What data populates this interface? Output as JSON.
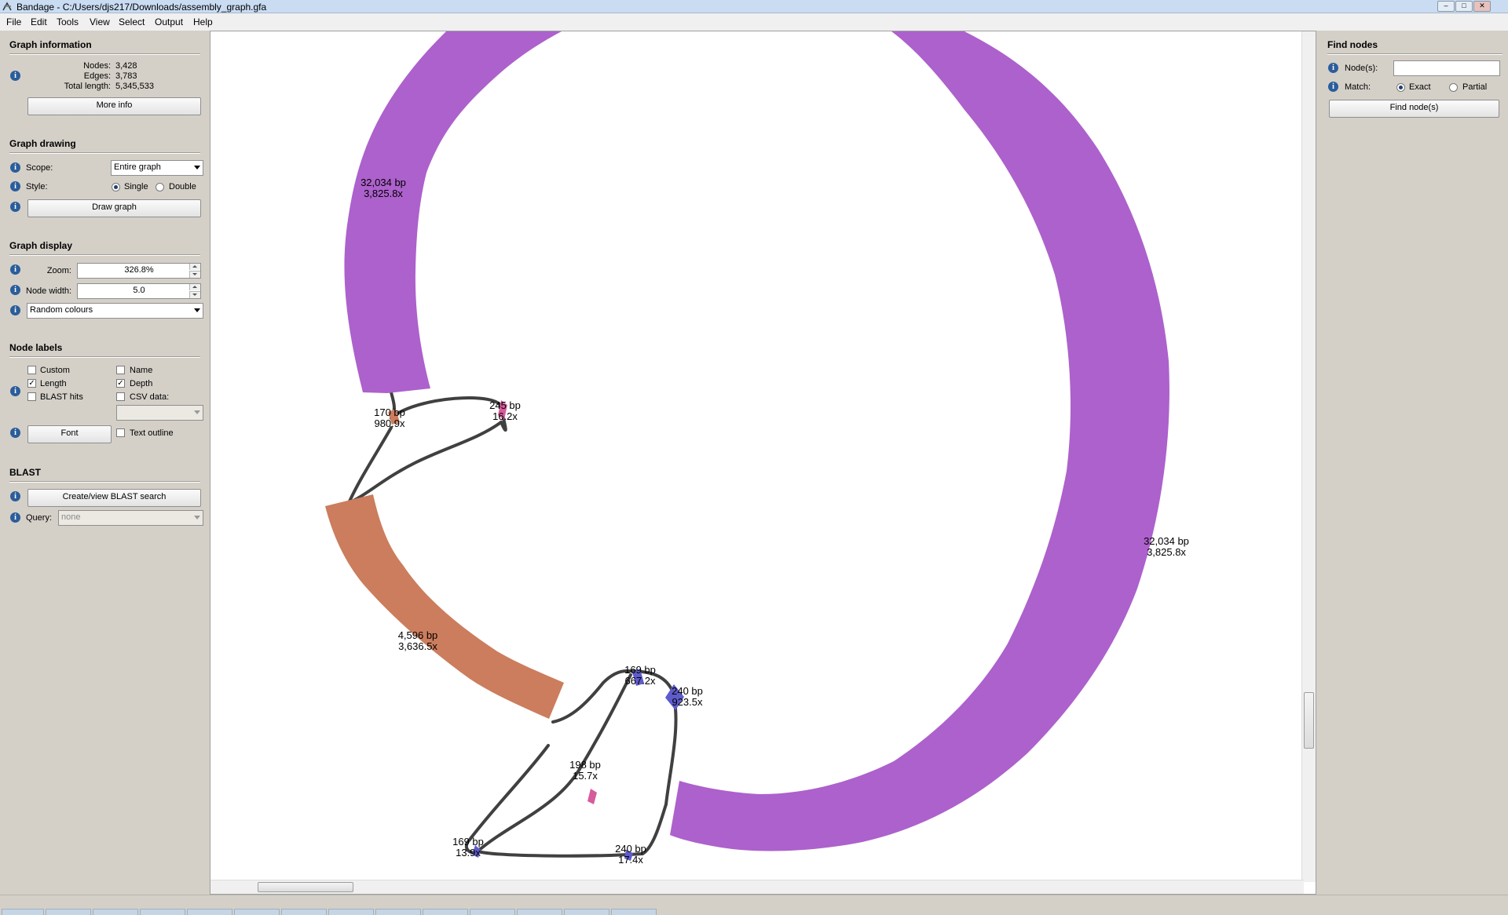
{
  "window": {
    "title": "Bandage - C:/Users/djs217/Downloads/assembly_graph.gfa"
  },
  "menu": [
    "File",
    "Edit",
    "Tools",
    "View",
    "Select",
    "Output",
    "Help"
  ],
  "graph_information": {
    "title": "Graph information",
    "nodes_label": "Nodes:",
    "nodes": "3,428",
    "edges_label": "Edges:",
    "edges": "3,783",
    "total_length_label": "Total length:",
    "total_length": "5,345,533",
    "more_info": "More info"
  },
  "graph_drawing": {
    "title": "Graph drawing",
    "scope_label": "Scope:",
    "scope_value": "Entire graph",
    "style_label": "Style:",
    "style_single": "Single",
    "style_double": "Double",
    "style_selected": "Single",
    "draw_graph": "Draw graph"
  },
  "graph_display": {
    "title": "Graph display",
    "zoom_label": "Zoom:",
    "zoom_value": "326.8%",
    "node_width_label": "Node width:",
    "node_width_value": "5.0",
    "colour_scheme": "Random colours"
  },
  "node_labels": {
    "title": "Node labels",
    "custom": "Custom",
    "custom_checked": false,
    "name": "Name",
    "name_checked": false,
    "length": "Length",
    "length_checked": true,
    "depth": "Depth",
    "depth_checked": true,
    "blast_hits": "BLAST hits",
    "blast_hits_checked": false,
    "csv_data": "CSV data:",
    "csv_data_checked": false,
    "font": "Font",
    "text_outline": "Text outline",
    "text_outline_checked": false
  },
  "blast": {
    "title": "BLAST",
    "create_view": "Create/view BLAST search",
    "query_label": "Query:",
    "query_value": "none"
  },
  "find_nodes": {
    "title": "Find nodes",
    "nodes_label": "Node(s):",
    "nodes_value": "",
    "match_label": "Match:",
    "match_exact": "Exact",
    "match_partial": "Partial",
    "match_selected": "Exact",
    "find_button": "Find node(s)"
  },
  "graph": {
    "colors": {
      "purple": "#ad61cc",
      "orange": "#cc7d5d",
      "pink": "#d65c9c",
      "blue": "#5e5ccc",
      "edge": "#404040"
    },
    "labels": [
      {
        "bp": "32,034 bp",
        "depth": "3,825.8x"
      },
      {
        "bp": "32,034 bp",
        "depth": "3,825.8x"
      },
      {
        "bp": "170 bp",
        "depth": "980.9x"
      },
      {
        "bp": "245 bp",
        "depth": "16.2x"
      },
      {
        "bp": "4,596 bp",
        "depth": "3,636.5x"
      },
      {
        "bp": "169 bp",
        "depth": "667.2x"
      },
      {
        "bp": "240 bp",
        "depth": "923.5x"
      },
      {
        "bp": "198 bp",
        "depth": "15.7x"
      },
      {
        "bp": "169 bp",
        "depth": "13.9x"
      },
      {
        "bp": "240 bp",
        "depth": "17.4x"
      }
    ]
  }
}
